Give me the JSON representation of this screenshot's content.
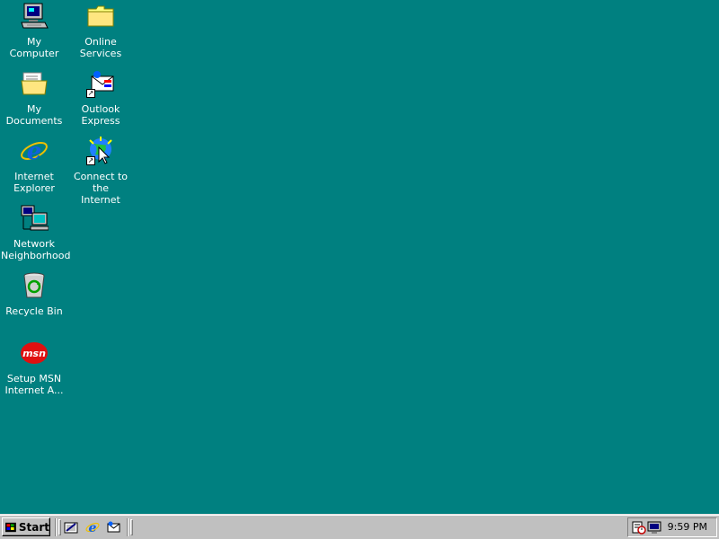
{
  "desktop": {
    "background_color": "#008080",
    "icons": [
      {
        "label": "My Computer",
        "icon": "computer-icon"
      },
      {
        "label": "Online\nServices",
        "icon": "folder-icon"
      },
      {
        "label": "My Documents",
        "icon": "documents-folder-icon"
      },
      {
        "label": "Outlook\nExpress",
        "icon": "outlook-express-icon"
      },
      {
        "label": "Internet\nExplorer",
        "icon": "internet-explorer-icon"
      },
      {
        "label": "Connect to the\nInternet",
        "icon": "connect-internet-icon"
      },
      {
        "label": "Network\nNeighborhood",
        "icon": "network-icon"
      },
      {
        "label": "Recycle Bin",
        "icon": "recycle-bin-icon"
      },
      {
        "label": "Setup MSN\nInternet A...",
        "icon": "msn-icon"
      }
    ]
  },
  "taskbar": {
    "start_label": "Start",
    "quick_launch": [
      {
        "icon": "show-desktop-icon"
      },
      {
        "icon": "internet-explorer-icon"
      },
      {
        "icon": "outlook-express-icon"
      }
    ],
    "tray": {
      "icons": [
        "scheduler-icon",
        "display-settings-icon"
      ],
      "clock": "9:59 PM"
    }
  }
}
